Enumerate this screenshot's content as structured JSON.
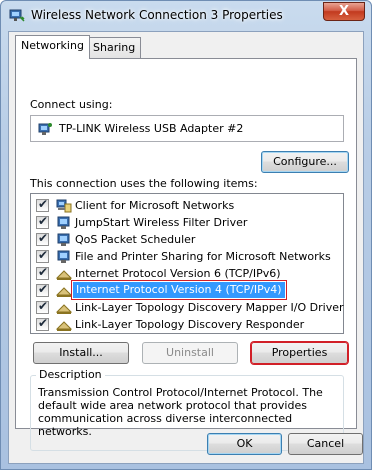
{
  "window": {
    "title": "Wireless Network Connection 3 Properties",
    "close_label": "X"
  },
  "tabs": [
    {
      "label": "Networking",
      "active": true
    },
    {
      "label": "Sharing",
      "active": false
    }
  ],
  "connect_using": {
    "label": "Connect using:",
    "adapter": "TP-LINK Wireless USB Adapter #2",
    "configure_label": "Configure..."
  },
  "items": {
    "label": "This connection uses the following items:",
    "list": [
      {
        "label": "Client for Microsoft Networks",
        "checked": true,
        "icon": "client-icon"
      },
      {
        "label": "JumpStart Wireless Filter Driver",
        "checked": true,
        "icon": "network-service-icon"
      },
      {
        "label": "QoS Packet Scheduler",
        "checked": true,
        "icon": "network-service-icon"
      },
      {
        "label": "File and Printer Sharing for Microsoft Networks",
        "checked": true,
        "icon": "network-service-icon"
      },
      {
        "label": "Internet Protocol Version 6 (TCP/IPv6)",
        "checked": true,
        "icon": "protocol-icon"
      },
      {
        "label": "Internet Protocol Version 4 (TCP/IPv4)",
        "checked": true,
        "icon": "protocol-icon",
        "selected": true
      },
      {
        "label": "Link-Layer Topology Discovery Mapper I/O Driver",
        "checked": true,
        "icon": "protocol-icon"
      },
      {
        "label": "Link-Layer Topology Discovery Responder",
        "checked": true,
        "icon": "protocol-icon"
      }
    ]
  },
  "buttons": {
    "install": "Install...",
    "uninstall": "Uninstall",
    "properties": "Properties",
    "ok": "OK",
    "cancel": "Cancel"
  },
  "description": {
    "legend": "Description",
    "text": "Transmission Control Protocol/Internet Protocol. The default wide area network protocol that provides communication across diverse interconnected networks."
  },
  "colors": {
    "selection": "#3399ff",
    "highlight_border": "#d11f27"
  }
}
